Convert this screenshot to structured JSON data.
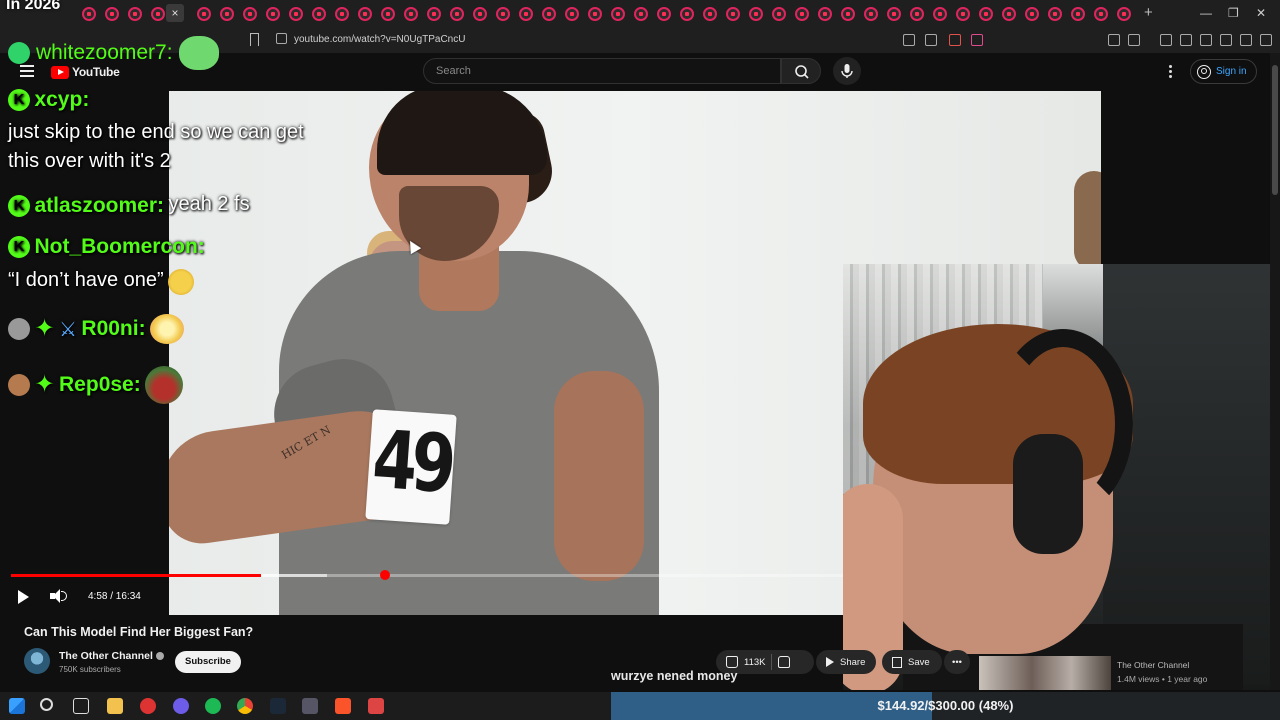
{
  "browser": {
    "url": "youtube.com/watch?v=N0UgTPaCncU",
    "tab_overlay_text": "In 2026",
    "new_tab_label": "+",
    "close_tab_label": "×",
    "window_controls": [
      "—",
      "❐",
      "✕"
    ]
  },
  "youtube": {
    "logo_text": "YouTube",
    "search_placeholder": "Search",
    "signin_label": "Sign in"
  },
  "player": {
    "time": "4:58 / 16:34",
    "progress_fraction": 0.3,
    "buffer_fraction": 0.38,
    "bib_number": "49",
    "tattoo_text": "HIC ET N"
  },
  "video_info": {
    "title": "Can This Model Find Her Biggest Fan?",
    "channel": "The Other Channel",
    "subscribers": "750K subscribers",
    "subscribe_label": "Subscribe",
    "likes": "113K",
    "share_label": "Share",
    "save_label": "Save"
  },
  "chat": {
    "top_user": "whitezoomer7:",
    "messages": [
      {
        "user": "xcyp:",
        "text": "just skip to the end so we can get this over with it's 2"
      },
      {
        "user": "atlaszoomer:",
        "text": "yeah 2 fs"
      },
      {
        "user": "Not_Boomercon:",
        "text": "“I don’t have one”"
      },
      {
        "user": "R00ni:",
        "text": ""
      },
      {
        "user": "Rep0se:",
        "text": ""
      }
    ],
    "accent": "#53fc18"
  },
  "caption": "wurzye nened money",
  "recommended": {
    "channel": "The Other Channel",
    "meta": "1.4M views • 1 year ago"
  },
  "goal": {
    "text": "$144.92/$300.00 (48%)",
    "fraction": 0.48
  },
  "colors": {
    "yt_red": "#ff0000",
    "kick_green": "#53fc18",
    "link_blue": "#3ea6ff"
  }
}
